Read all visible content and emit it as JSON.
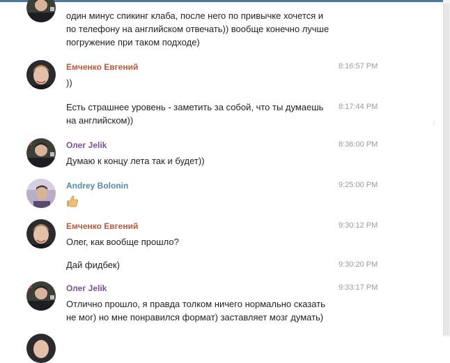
{
  "colors": {
    "emchenko": "#c0583c",
    "oleg": "#7a4fa0",
    "andrey": "#4f8ab4",
    "timestamp": "#9a9a9a",
    "top_bar": "#4c79a0"
  },
  "messages": [
    {
      "author": "",
      "avatar_icon": "oleg-avatar-icon",
      "time": "",
      "text": "один минус спикинг клаба, после него по привычке хочется и по телефону на английском отвечать)) вообще конечно лучше погружение при таком подходе)"
    },
    {
      "author": "Емченко Евгений",
      "avatar_icon": "emchenko-avatar-icon",
      "time": "8:16:57 PM",
      "text": "))"
    },
    {
      "author": "",
      "time": "8:17:44 PM",
      "text": "Есть страшнее уровень - заметить за собой, что ты думаешь на английском))"
    },
    {
      "author": "Олег Jelik",
      "avatar_icon": "oleg-avatar-icon",
      "time": "8:36:00 PM",
      "text": "Думаю к концу лета так и будет))"
    },
    {
      "author": "Andrey Bolonin",
      "avatar_icon": "andrey-avatar-icon",
      "time": "9:25:00 PM",
      "emoji": "thumbs-up-icon"
    },
    {
      "author": "Емченко Евгений",
      "avatar_icon": "emchenko-avatar-icon",
      "time": "9:30:12 PM",
      "text": "Олег, как вообще прошло?"
    },
    {
      "author": "",
      "time": "9:30:20 PM",
      "text": "Дай фидбек)"
    },
    {
      "author": "Олег Jelik",
      "avatar_icon": "oleg-avatar-icon",
      "time": "9:33:17 PM",
      "text": "Отлично прошло, я правда толком ничего нормально сказать не мог) но мне понравился формат) заставляет мозг думать)"
    }
  ]
}
